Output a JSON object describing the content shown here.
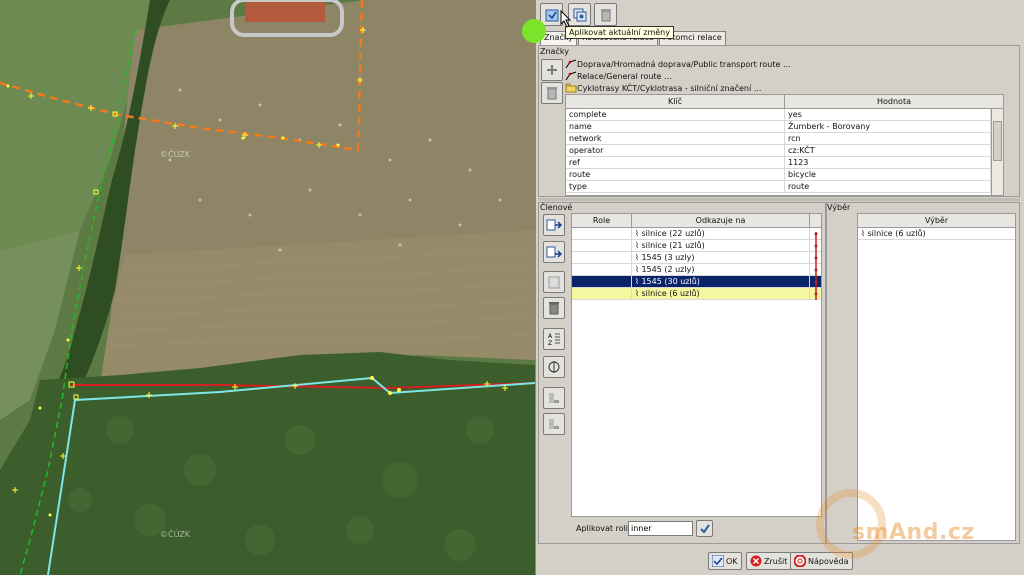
{
  "map": {
    "watermark_1": "©ČÚZK",
    "watermark_2": "©ČÚZK"
  },
  "toolbar": {
    "tooltip": "Aplikovat aktuální změny"
  },
  "tabs": [
    {
      "label": "Značky",
      "active": true
    },
    {
      "label": "Rodičovské relace",
      "active": false
    },
    {
      "label": "Potomci relace",
      "active": false
    }
  ],
  "tags": {
    "title": "Značky",
    "groups": [
      {
        "label": "Doprava/Hromadná doprava/Public transport route ..."
      },
      {
        "label": "Relace/General route ..."
      },
      {
        "label": "Cyklotrasy KČT/Cyklotrasa - silniční značení ..."
      }
    ],
    "columns": [
      "Klíč",
      "Hodnota"
    ],
    "rows": [
      {
        "key": "complete",
        "value": "yes"
      },
      {
        "key": "name",
        "value": "Žumberk - Borovany"
      },
      {
        "key": "network",
        "value": "rcn"
      },
      {
        "key": "operator",
        "value": "cz:KČT"
      },
      {
        "key": "ref",
        "value": "1123"
      },
      {
        "key": "route",
        "value": "bicycle"
      },
      {
        "key": "type",
        "value": "route"
      }
    ]
  },
  "members": {
    "title": "Členové",
    "columns": [
      "Role",
      "Odkazuje na"
    ],
    "rows": [
      {
        "role": "",
        "ref": "silnice (22 uzlů)",
        "state": "normal"
      },
      {
        "role": "",
        "ref": "silnice (21 uzlů)",
        "state": "normal"
      },
      {
        "role": "",
        "ref": "1545 (3 uzly)",
        "state": "normal"
      },
      {
        "role": "",
        "ref": "1545 (2 uzly)",
        "state": "normal"
      },
      {
        "role": "",
        "ref": "1545 (30 uzlů)",
        "state": "selected"
      },
      {
        "role": "",
        "ref": "silnice (6 uzlů)",
        "state": "highlight"
      }
    ],
    "apply_role_label": "Aplikovat roli:",
    "role_value": "inner"
  },
  "selection": {
    "title": "Výběr",
    "column": "Výběr",
    "rows": [
      {
        "ref": "silnice (6 uzlů)"
      }
    ]
  },
  "buttons": {
    "ok": "OK",
    "cancel": "Zrušit",
    "help": "Nápověda"
  },
  "branding": {
    "logo": "smAnd.cz"
  }
}
